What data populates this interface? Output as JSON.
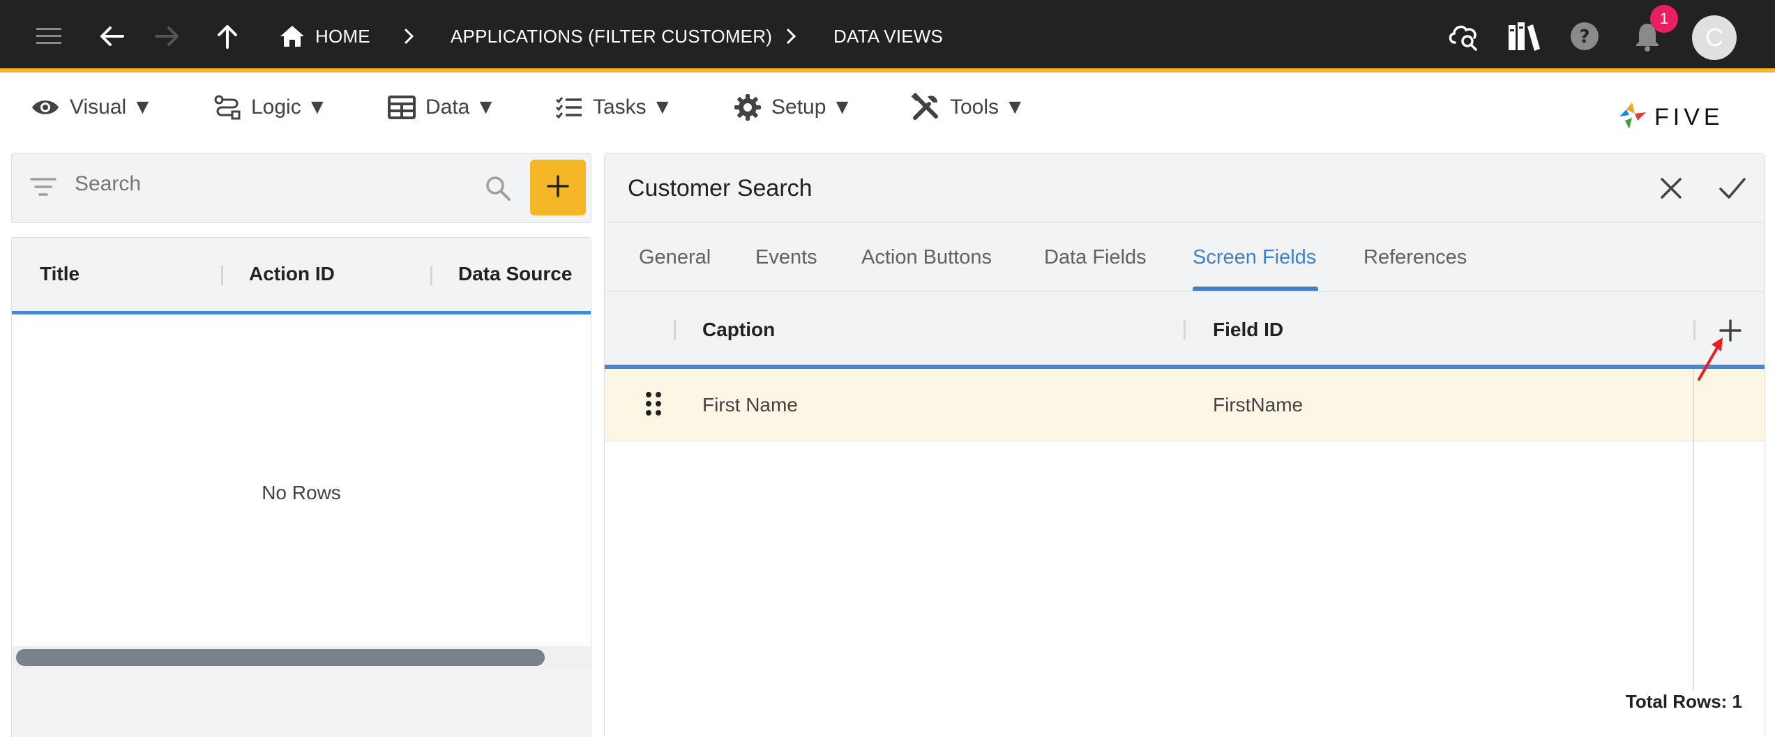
{
  "topbar": {
    "breadcrumb": [
      {
        "label": "HOME"
      },
      {
        "label": "APPLICATIONS (FILTER CUSTOMER)"
      },
      {
        "label": "DATA VIEWS"
      }
    ],
    "notification_count": "1",
    "avatar_initial": "C"
  },
  "menu": {
    "items": [
      {
        "label": "Visual ▼",
        "icon": "eye-icon"
      },
      {
        "label": "Logic ▼",
        "icon": "logic-icon"
      },
      {
        "label": "Data ▼",
        "icon": "table-icon"
      },
      {
        "label": "Tasks ▼",
        "icon": "tasks-icon"
      },
      {
        "label": "Setup ▼",
        "icon": "gear-icon"
      },
      {
        "label": "Tools ▼",
        "icon": "tools-icon"
      }
    ],
    "logo_text": "FIVE"
  },
  "left": {
    "search_placeholder": "Search",
    "columns": [
      "Title",
      "Action ID",
      "Data Source"
    ],
    "empty_text": "No Rows"
  },
  "right": {
    "title": "Customer Search",
    "tabs": [
      {
        "label": "General"
      },
      {
        "label": "Events"
      },
      {
        "label": "Action Buttons"
      },
      {
        "label": "Data Fields"
      },
      {
        "label": "Screen Fields",
        "active": true
      },
      {
        "label": "References"
      }
    ],
    "columns": [
      "Caption",
      "Field ID"
    ],
    "rows": [
      {
        "caption": "First Name",
        "field_id": "FirstName"
      }
    ],
    "total_rows": "Total Rows: 1"
  },
  "colors": {
    "accent": "#f5b728",
    "topbar": "#222222",
    "tab_active": "#3f7fcb",
    "row_highlight": "#fef6e4",
    "badge": "#e91e63"
  }
}
